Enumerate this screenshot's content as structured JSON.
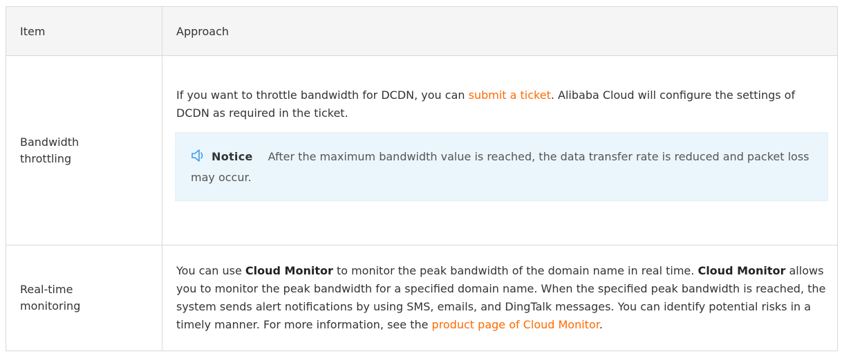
{
  "table": {
    "headers": {
      "item": "Item",
      "approach": "Approach"
    },
    "rows": [
      {
        "item_line1": "Bandwidth",
        "item_line2": "throttling",
        "text_before_link": "If you want to throttle bandwidth for DCDN, you can ",
        "link_text": "submit a ticket",
        "text_after_link": ". Alibaba Cloud will configure the settings of DCDN as required in the ticket.",
        "notice": {
          "icon": "bell-icon",
          "title": "Notice",
          "text": "After the maximum bandwidth value is reached, the data transfer rate is reduced and packet loss may occur."
        }
      },
      {
        "item_line1": "Real-time",
        "item_line2": "monitoring",
        "text_part1": "You can use ",
        "bold1": "Cloud Monitor",
        "text_part2": " to monitor the peak bandwidth of the domain name in real time. ",
        "bold2": "Cloud Monitor",
        "text_part3": " allows you to monitor the peak bandwidth for a specified domain name. When the specified peak bandwidth is reached, the system sends alert notifications by using SMS, emails, and DingTalk messages. You can identify potential risks in a timely manner. For more information, see the ",
        "link_text": "product page of Cloud Monitor",
        "text_end": "."
      }
    ]
  },
  "colors": {
    "link": "#ff6a00",
    "header_bg": "#f5f5f5",
    "notice_bg": "#eaf6fc",
    "notice_icon": "#3f9be6",
    "border": "#d9d9d9"
  }
}
